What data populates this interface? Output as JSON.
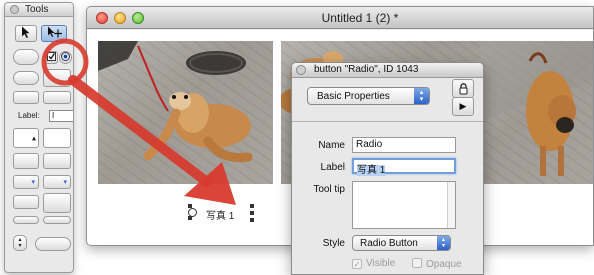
{
  "tools_palette": {
    "title": "Tools",
    "label_tool": "Label:",
    "label_box_text": "I"
  },
  "window": {
    "title": "Untitled 1 (2) *",
    "radio_label": "写真 1"
  },
  "inspector": {
    "title": "button \"Radio\", ID 1043",
    "property_group": "Basic Properties",
    "name_label": "Name",
    "name_value": "Radio",
    "label_label": "Label",
    "label_value": "写真 1",
    "tooltip_label": "Tool tip",
    "tooltip_value": "",
    "style_label": "Style",
    "style_value": "Radio Button",
    "visible_label": "Visible",
    "visible_checked": true,
    "opaque_label": "Opaque",
    "opaque_checked": false
  },
  "colors": {
    "annotation": "#d83a2e",
    "selection_highlight": "#b7d1f5",
    "popup_accent": "#2b63c8"
  },
  "icons": [
    "cursor-arrow-icon",
    "cursor-crosshair-icon",
    "lock-icon",
    "play-icon",
    "checkbox-icon",
    "radio-icon"
  ]
}
